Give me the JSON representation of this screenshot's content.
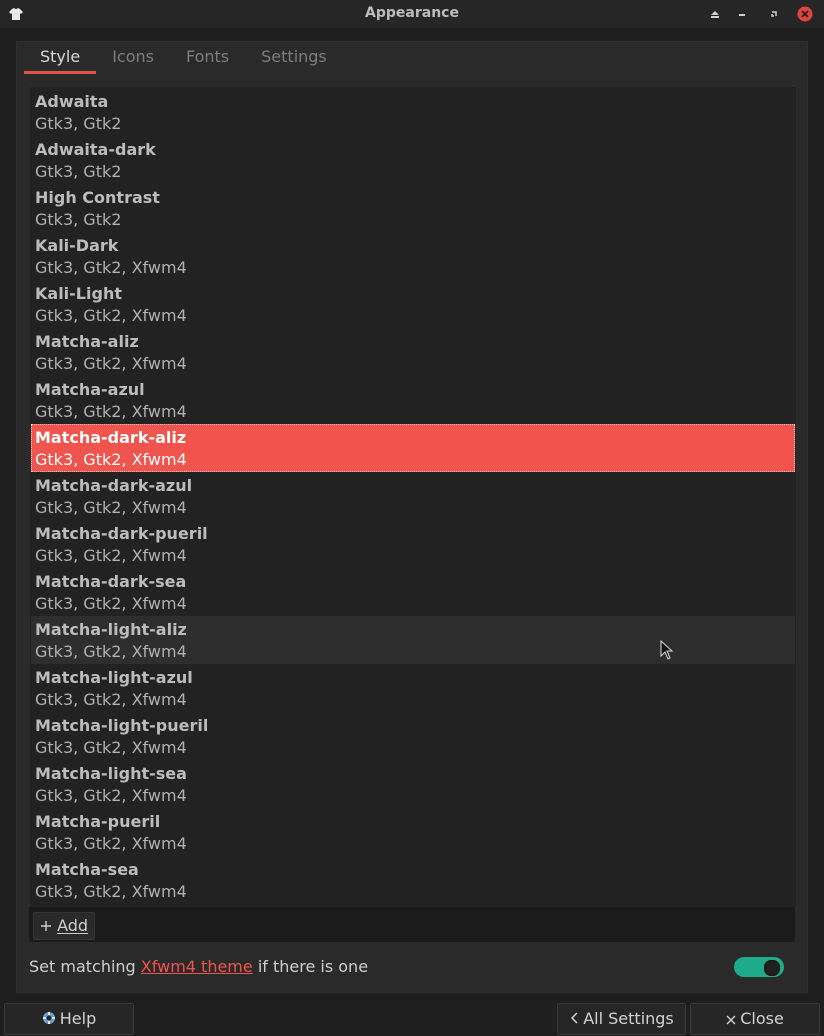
{
  "window": {
    "title": "Appearance"
  },
  "tabs": [
    {
      "label": "Style"
    },
    {
      "label": "Icons"
    },
    {
      "label": "Fonts"
    },
    {
      "label": "Settings"
    }
  ],
  "themes": [
    {
      "name": "Adwaita",
      "caps": "Gtk3, Gtk2"
    },
    {
      "name": "Adwaita-dark",
      "caps": "Gtk3, Gtk2"
    },
    {
      "name": "High Contrast",
      "caps": "Gtk3, Gtk2"
    },
    {
      "name": "Kali-Dark",
      "caps": "Gtk3, Gtk2, Xfwm4"
    },
    {
      "name": "Kali-Light",
      "caps": "Gtk3, Gtk2, Xfwm4"
    },
    {
      "name": "Matcha-aliz",
      "caps": "Gtk3, Gtk2, Xfwm4"
    },
    {
      "name": "Matcha-azul",
      "caps": "Gtk3, Gtk2, Xfwm4"
    },
    {
      "name": "Matcha-dark-aliz",
      "caps": "Gtk3, Gtk2, Xfwm4"
    },
    {
      "name": "Matcha-dark-azul",
      "caps": "Gtk3, Gtk2, Xfwm4"
    },
    {
      "name": "Matcha-dark-pueril",
      "caps": "Gtk3, Gtk2, Xfwm4"
    },
    {
      "name": "Matcha-dark-sea",
      "caps": "Gtk3, Gtk2, Xfwm4"
    },
    {
      "name": "Matcha-light-aliz",
      "caps": "Gtk3, Gtk2, Xfwm4"
    },
    {
      "name": "Matcha-light-azul",
      "caps": "Gtk3, Gtk2, Xfwm4"
    },
    {
      "name": "Matcha-light-pueril",
      "caps": "Gtk3, Gtk2, Xfwm4"
    },
    {
      "name": "Matcha-light-sea",
      "caps": "Gtk3, Gtk2, Xfwm4"
    },
    {
      "name": "Matcha-pueril",
      "caps": "Gtk3, Gtk2, Xfwm4"
    },
    {
      "name": "Matcha-sea",
      "caps": "Gtk3, Gtk2, Xfwm4"
    }
  ],
  "selected_theme": "Matcha-dark-aliz",
  "hovered_theme": "Matcha-light-aliz",
  "add_button": {
    "label": "Add",
    "icon": "plus-icon"
  },
  "option": {
    "prefix": "Set matching ",
    "link": "Xfwm4 theme",
    "suffix": " if there is one",
    "enabled": true
  },
  "footer": {
    "help_label": "Help",
    "all_settings_label": "All Settings",
    "close_label": "Close"
  },
  "colors": {
    "accent": "#f1544c",
    "toggle_on": "#1dab8a"
  }
}
